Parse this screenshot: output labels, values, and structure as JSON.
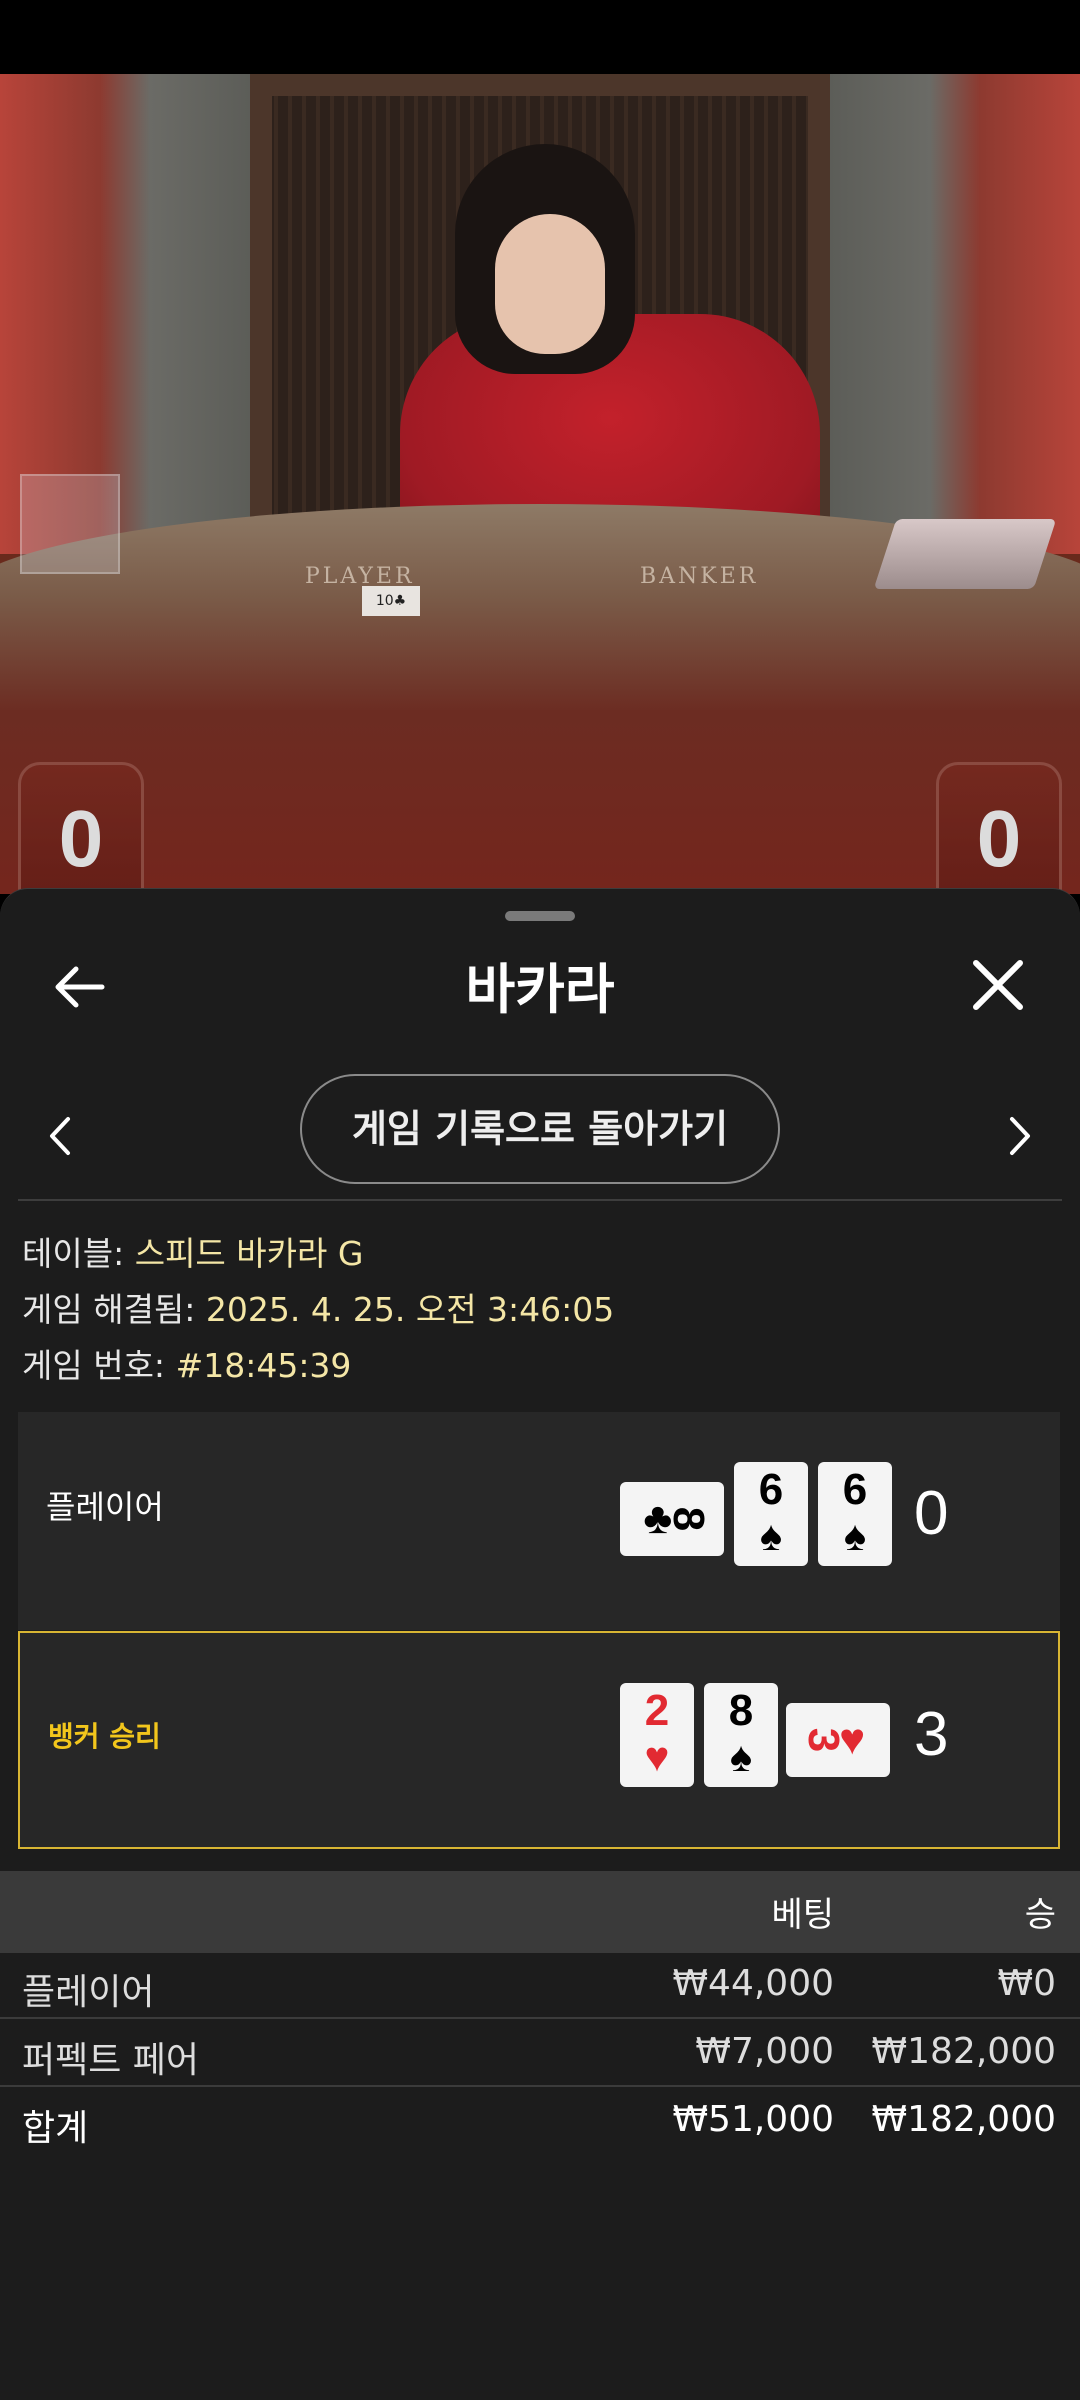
{
  "video": {
    "table_player_text": "PLAYER",
    "table_banker_text": "BANKER",
    "table_card": "10♣",
    "player_score": "0",
    "banker_score": "0"
  },
  "sheet": {
    "title": "바카라",
    "back_history_label": "게임 기록으로 돌아가기"
  },
  "info": {
    "table_label": "테이블:",
    "table_value": "스피드 바카라 G",
    "resolved_label": "게임 해결됨:",
    "resolved_value": "2025. 4. 25. 오전 3:46:05",
    "game_no_label": "게임 번호:",
    "game_no_value": "#18:45:39"
  },
  "hands": {
    "player": {
      "label": "플레이어",
      "total": "0",
      "cards": [
        {
          "rank": "8",
          "suit": "♣",
          "color": "black",
          "orientation": "landscape"
        },
        {
          "rank": "6",
          "suit": "♠",
          "color": "black",
          "orientation": "portrait"
        },
        {
          "rank": "6",
          "suit": "♠",
          "color": "black",
          "orientation": "portrait"
        }
      ]
    },
    "banker": {
      "label": "뱅커 승리",
      "total": "3",
      "cards": [
        {
          "rank": "2",
          "suit": "♥",
          "color": "red",
          "orientation": "portrait"
        },
        {
          "rank": "8",
          "suit": "♠",
          "color": "black",
          "orientation": "portrait"
        },
        {
          "rank": "3",
          "suit": "♥",
          "color": "red",
          "orientation": "landscape"
        }
      ]
    }
  },
  "bets": {
    "col_bet": "베팅",
    "col_win": "승",
    "rows": [
      {
        "name": "플레이어",
        "bet": "₩44,000",
        "win": "₩0"
      },
      {
        "name": "퍼펙트 페어",
        "bet": "₩7,000",
        "win": "₩182,000"
      }
    ],
    "total": {
      "name": "합계",
      "bet": "₩51,000",
      "win": "₩182,000"
    }
  },
  "colors": {
    "accent_gold": "#d8b533",
    "winner_label": "#f2c61c",
    "info_value": "#f4e6a6",
    "sheet_bg": "#1c1c1c"
  }
}
